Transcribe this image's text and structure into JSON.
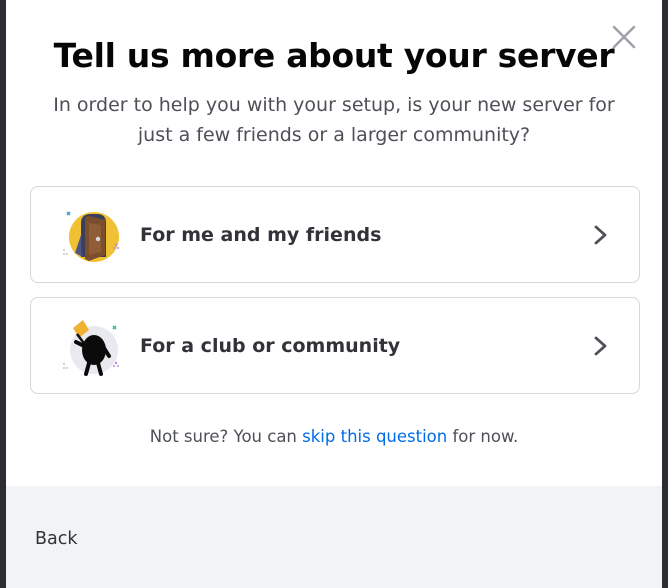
{
  "modal": {
    "title": "Tell us more about your server",
    "subtitle": "In order to help you with your setup, is your new server for just a few friends or a larger community?",
    "close_icon": "close-icon"
  },
  "options": [
    {
      "label": "For me and my friends",
      "icon": "door-illustration-icon",
      "chevron": "chevron-right-icon"
    },
    {
      "label": "For a club or community",
      "icon": "flag-character-illustration-icon",
      "chevron": "chevron-right-icon"
    }
  ],
  "skip": {
    "prefix": "Not sure? You can ",
    "link": "skip this question",
    "suffix": " for now."
  },
  "footer": {
    "back_label": "Back"
  },
  "colors": {
    "link": "#006ce7",
    "title": "#060607",
    "text": "#4e5058",
    "footer_bg": "#f2f3f5",
    "border": "#d4d7dc"
  }
}
